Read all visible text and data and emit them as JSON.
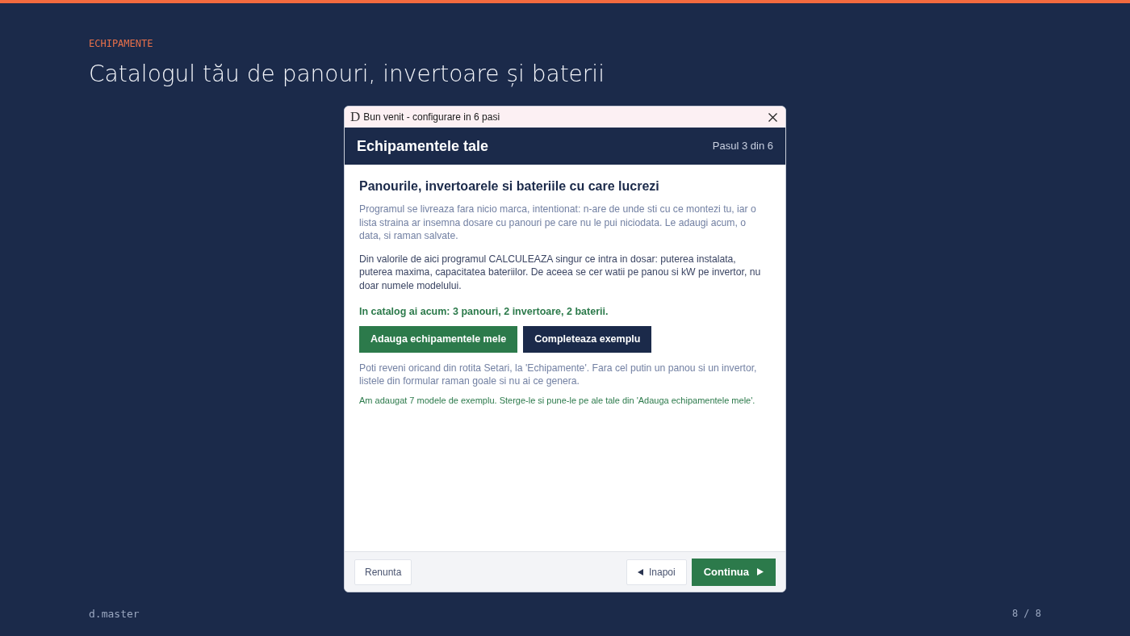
{
  "slide": {
    "kicker": "ECHIPAMENTE",
    "title": "Catalogul tău de panouri, invertoare și baterii",
    "brand": "d.master",
    "page": "8 / 8"
  },
  "dialog": {
    "logo": "D",
    "title": "Bun venit - configurare in 6 pasi",
    "header": {
      "title": "Echipamentele tale",
      "step": "Pasul 3 din 6"
    },
    "heading": "Panourile, invertoarele si bateriile cu care lucrezi",
    "blocks": [
      {
        "kind": "muted",
        "text": "Programul se livreaza fara nicio marca, intentionat: n-are de unde sti cu ce montezi tu, iar o lista straina ar insemna dosare cu panouri pe care nu le pui niciodata. Le adaugi acum, o data, si raman salvate."
      },
      {
        "kind": "body",
        "text": "Din valorile de aici programul CALCULEAZA singur ce intra in dosar: puterea instalata, puterea maxima, capacitatea bateriilor. De aceea se cer watii pe panou si kW pe invertor, nu doar numele modelului."
      },
      {
        "kind": "status",
        "text": "In catalog ai acum: 3 panouri, 2 invertoare, 2 baterii."
      },
      {
        "kind": "actions",
        "buttons": [
          {
            "kind": "primary",
            "label": "Adauga echipamentele mele"
          },
          {
            "kind": "dark",
            "label": "Completeaza exemplu"
          }
        ]
      },
      {
        "kind": "muted",
        "text": "Poti reveni oricand din rotita Setari, la 'Echipamente'. Fara cel putin un panou si un invertor, listele din formular raman goale si nu ai ce genera."
      },
      {
        "kind": "note",
        "text": "Am adaugat 7 modele de exemplu. Sterge-le si pune-le pe ale tale din 'Adauga echipamentele mele'."
      }
    ],
    "footer": {
      "buttons": [
        {
          "kind": "cancel",
          "label": "Renunta"
        },
        {
          "kind": "back",
          "label": "Inapoi"
        },
        {
          "kind": "next",
          "label": "Continua"
        }
      ]
    }
  }
}
